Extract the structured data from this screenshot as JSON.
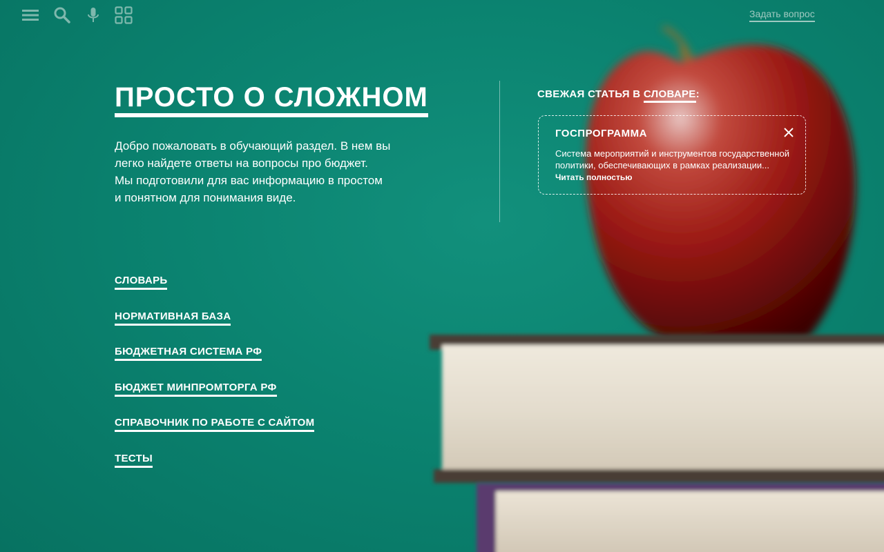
{
  "topbar": {
    "icons": [
      "menu-icon",
      "search-icon",
      "microphone-icon",
      "grid-icon"
    ],
    "ask_link": "Задать вопрос"
  },
  "main": {
    "title": "ПРОСТО О СЛОЖНОМ",
    "intro_lines": [
      "Добро пожаловать в обучающий раздел. В нем вы",
      "легко найдете ответы на вопросы про бюджет.",
      "Мы подготовили для вас информацию в простом",
      "и понятном для понимания виде."
    ],
    "nav": [
      {
        "label": "СЛОВАРЬ"
      },
      {
        "label": "НОРМАТИВНАЯ БАЗА"
      },
      {
        "label": "БЮДЖЕТНАЯ СИСТЕМА РФ"
      },
      {
        "label": "БЮДЖЕТ МИНПРОМТОРГА РФ"
      },
      {
        "label": "СПРАВОЧНИК ПО РАБОТЕ С САЙТОМ"
      },
      {
        "label": "ТЕСТЫ"
      }
    ]
  },
  "fresh": {
    "heading_prefix": "СВЕЖАЯ СТАТЬЯ В ",
    "heading_link": "СЛОВАРЕ",
    "heading_suffix": ":",
    "card": {
      "title": "ГОСПРОГРАММА",
      "text_lines": [
        "Система мероприятий и инструментов государственной",
        "политики, обеспечивающих в рамках реализации..."
      ],
      "read_more": "Читать полностью"
    }
  },
  "colors": {
    "background": "#0b8370",
    "text": "#ffffff",
    "muted_link": "#9fc9c0"
  }
}
